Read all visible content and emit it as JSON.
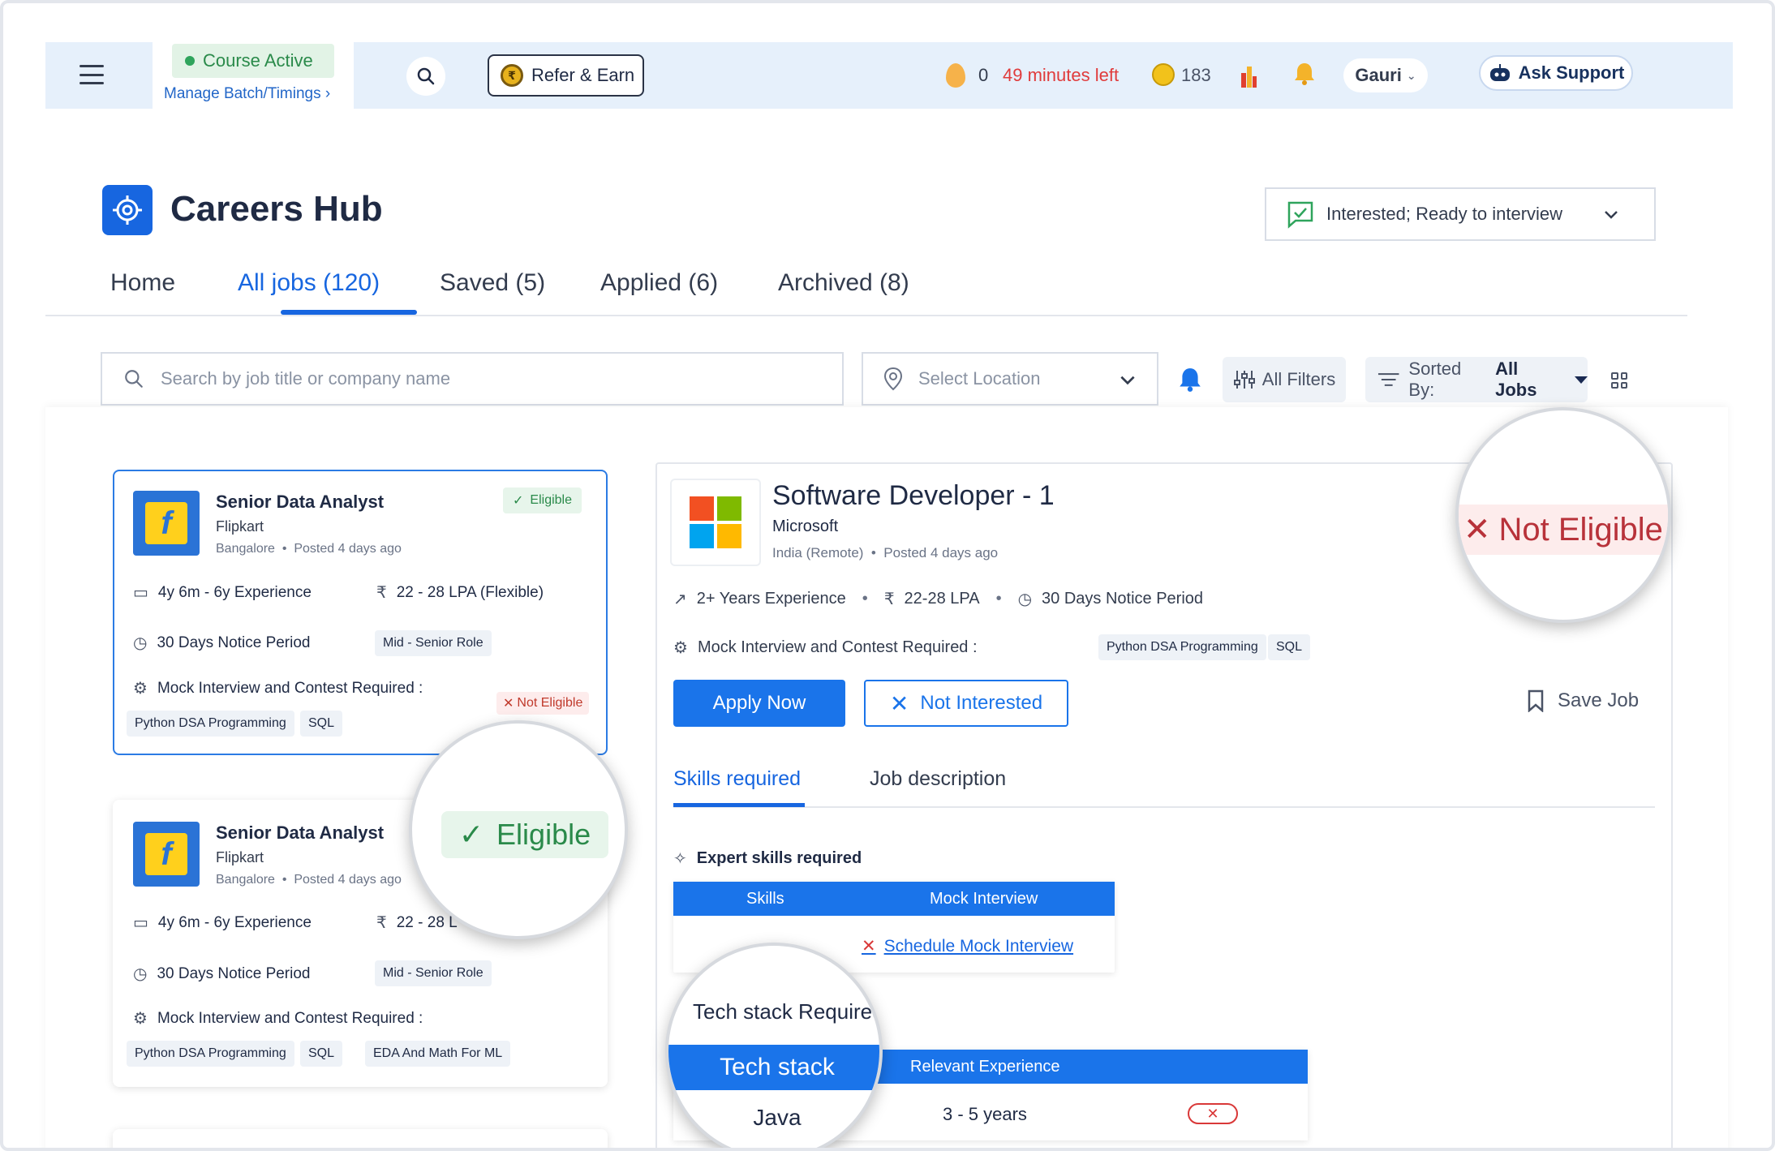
{
  "topbar": {
    "course_status": "Course Active",
    "manage_link": "Manage Batch/Timings ›",
    "refer_label": "Refer & Earn",
    "streak": "0",
    "time_left": "49 minutes left",
    "coins": "183",
    "user_name": "Gauri",
    "support_label": "Ask Support"
  },
  "header": {
    "title": "Careers Hub",
    "status_dropdown": "Interested; Ready to interview"
  },
  "tabs": [
    {
      "label": "Home"
    },
    {
      "label": "All jobs (120)"
    },
    {
      "label": "Saved (5)"
    },
    {
      "label": "Applied (6)"
    },
    {
      "label": "Archived (8)"
    }
  ],
  "search": {
    "placeholder": "Search by job title or company name",
    "location_placeholder": "Select Location",
    "filters_label": "All Filters",
    "sort_prefix": "Sorted By:",
    "sort_value": "All Jobs"
  },
  "cards": [
    {
      "title": "Senior Data Analyst",
      "company": "Flipkart",
      "location": "Bangalore",
      "posted": "Posted 4 days ago",
      "badge": "Eligible",
      "experience": "4y 6m - 6y Experience",
      "salary": "22 - 28 LPA (Flexible)",
      "notice": "30 Days Notice Period",
      "role": "Mid - Senior Role",
      "mock_label": "Mock Interview and Contest  Required :",
      "status": "Not Eligible",
      "tags": [
        "Python DSA Programming",
        "SQL"
      ]
    },
    {
      "title": "Senior Data Analyst",
      "company": "Flipkart",
      "location": "Bangalore",
      "posted": "Posted 4 days ago",
      "badge": "Eligible",
      "experience": "4y 6m - 6y Experience",
      "salary": "22 - 28 L",
      "notice": "30 Days Notice Period",
      "role": "Mid - Senior Role",
      "mock_label": "Mock Interview and Contest  Required :",
      "tags": [
        "Python DSA Programming",
        "SQL",
        "EDA And Math For ML"
      ]
    }
  ],
  "detail": {
    "title": "Software Developer - 1",
    "company": "Microsoft",
    "location": "India (Remote)",
    "posted": "Posted 4 days ago",
    "experience": "2+ Years Experience",
    "salary": "22-28 LPA",
    "notice": "30 Days Notice Period",
    "mock_label": "Mock Interview and Contest  Required :",
    "tags": [
      "Python DSA Programming",
      "SQL"
    ],
    "eligibility": "Not Eligible",
    "apply_label": "Apply Now",
    "not_interested_label": "Not Interested",
    "save_label": "Save Job",
    "tab_skills": "Skills required",
    "tab_description": "Job description",
    "expert_label": "Expert skills required",
    "skills_col": "Skills",
    "mock_col": "Mock Interview",
    "schedule_link": "Schedule Mock Interview",
    "tech_heading": "Tech stack Required",
    "tech_col": "Tech stack",
    "relexp_col": "Relevant Experience",
    "tech_value": "Java",
    "relexp_value": "3  - 5 years",
    "x_mark": "✕"
  },
  "colors": {
    "brand_blue": "#1766e0",
    "eligible_green": "#2a8a4a",
    "not_eligible_red": "#c0392b",
    "topbar_bg": "#e6f0fb"
  }
}
